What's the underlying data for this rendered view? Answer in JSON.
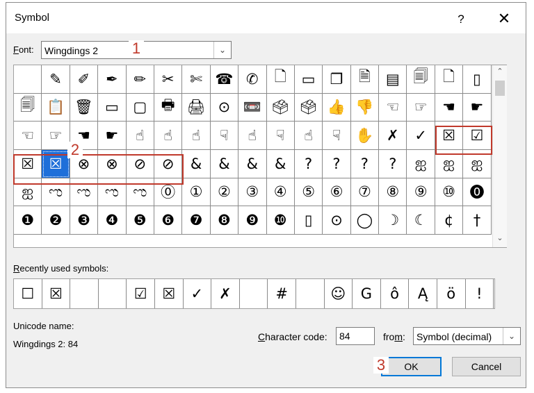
{
  "window": {
    "title": "Symbol",
    "help_label": "?",
    "close_label": "✕"
  },
  "font": {
    "label_u": "F",
    "label_rest": "ont:",
    "value": "Wingdings 2"
  },
  "grid": {
    "cells": [
      "",
      "✎",
      "✐",
      "✒",
      "✏",
      "✂",
      "✄",
      "☎",
      "✆",
      "🗋",
      "▭",
      "❐",
      "🗎",
      "▤",
      "🗐",
      "🗋",
      "▯",
      "🗐",
      "📋",
      "🗑",
      "▭",
      "▢",
      "🖶",
      "🖨",
      "⊙",
      "📼",
      "🗳",
      "🗳",
      "👍",
      "👎",
      "☜",
      "☞",
      "☚",
      "☛",
      "☜",
      "☞",
      "☚",
      "☛",
      "☝",
      "☝",
      "☝",
      "☟",
      "☝",
      "☟",
      "☝",
      "☟",
      "✋",
      "✗",
      "✓",
      "☒",
      "☑",
      "☒",
      "☒",
      "⊗",
      "⊗",
      "⊘",
      "⊘",
      "&",
      "&",
      "&",
      "&",
      "?",
      "?",
      "?",
      "?",
      "ஐ",
      "ஐ",
      "ஐ",
      "ஐ",
      "ಌ",
      "ಌ",
      "ಌ",
      "ಌ",
      "⓪",
      "①",
      "②",
      "③",
      "④",
      "⑤",
      "⑥",
      "⑦",
      "⑧",
      "⑨",
      "⑩",
      "⓿",
      "❶",
      "❷",
      "❸",
      "❹",
      "❺",
      "❻",
      "❼",
      "❽",
      "❾",
      "❿",
      "▯",
      "⊙",
      "◯",
      "☽",
      "☾",
      "¢",
      "†"
    ]
  },
  "recent": {
    "label_u": "R",
    "label_rest": "ecently used symbols:",
    "cells": [
      "☐",
      "☒",
      "",
      "",
      "☑",
      "☒",
      "✓",
      "✗",
      "",
      "#",
      "",
      "☺",
      "G",
      "ô",
      "Ą",
      "ö",
      "!"
    ]
  },
  "unicode_name": {
    "label": "Unicode name:",
    "value": "Wingdings 2: 84"
  },
  "character_code": {
    "label_u": "C",
    "label_rest": "haracter code:",
    "value": "84"
  },
  "from": {
    "label_pre": "fro",
    "label_u": "m",
    "label_post": ":",
    "value": "Symbol (decimal)"
  },
  "buttons": {
    "ok": "OK",
    "cancel": "Cancel"
  },
  "callouts": [
    "1",
    "2",
    "3"
  ],
  "accent_color": "#c0392b",
  "selection_color": "#1e6fd9"
}
